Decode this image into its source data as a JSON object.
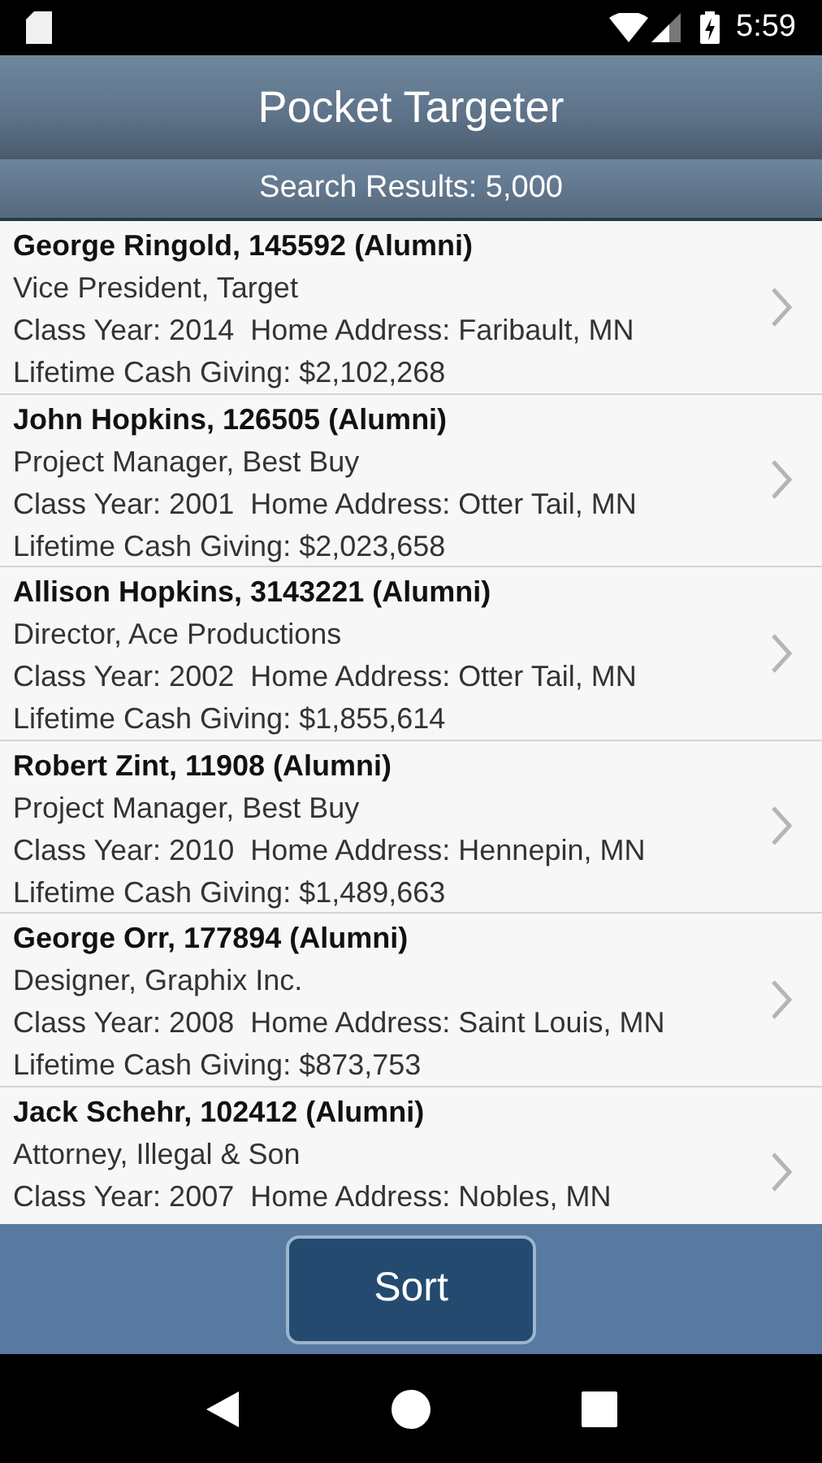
{
  "status_bar": {
    "time": "5:59"
  },
  "header": {
    "title": "Pocket Targeter"
  },
  "results_bar": {
    "text": "Search Results: 5,000"
  },
  "results": [
    {
      "name": "George Ringold, 145592 (Alumni)",
      "position": "Vice President, Target",
      "class_year": "Class Year: 2014",
      "home_address": "Home Address: Faribault, MN",
      "giving": "Lifetime Cash Giving: $2,102,268"
    },
    {
      "name": "John Hopkins, 126505 (Alumni)",
      "position": "Project Manager, Best Buy",
      "class_year": "Class Year: 2001",
      "home_address": "Home Address: Otter Tail, MN",
      "giving": "Lifetime Cash Giving: $2,023,658"
    },
    {
      "name": "Allison Hopkins, 3143221 (Alumni)",
      "position": "Director, Ace Productions",
      "class_year": "Class Year: 2002",
      "home_address": "Home Address: Otter Tail, MN",
      "giving": "Lifetime Cash Giving: $1,855,614"
    },
    {
      "name": "Robert Zint, 11908 (Alumni)",
      "position": "Project Manager, Best Buy",
      "class_year": "Class Year: 2010",
      "home_address": "Home Address: Hennepin, MN",
      "giving": "Lifetime Cash Giving: $1,489,663"
    },
    {
      "name": "George Orr, 177894 (Alumni)",
      "position": "Designer, Graphix Inc.",
      "class_year": "Class Year: 2008",
      "home_address": "Home Address: Saint Louis, MN",
      "giving": "Lifetime Cash Giving: $873,753"
    },
    {
      "name": "Jack Schehr, 102412 (Alumni)",
      "position": "Attorney, Illegal & Son",
      "class_year": "Class Year: 2007",
      "home_address": "Home Address: Nobles, MN"
    }
  ],
  "sort_button": {
    "label": "Sort"
  }
}
